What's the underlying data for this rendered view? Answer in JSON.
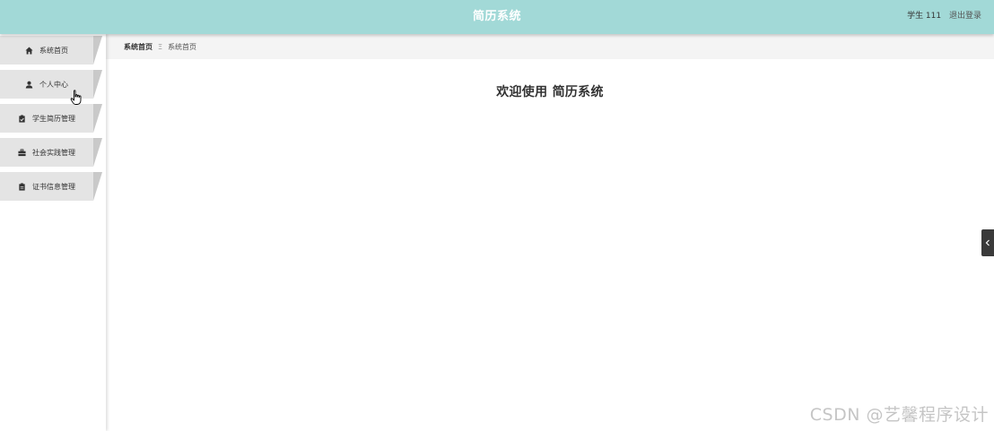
{
  "header": {
    "title": "简历系统",
    "user": "学生 111",
    "logout": "退出登录"
  },
  "sidebar": {
    "items": [
      {
        "label": "系统首页",
        "icon": "home-icon"
      },
      {
        "label": "个人中心",
        "icon": "user-icon"
      },
      {
        "label": "学生简历管理",
        "icon": "clipboard-icon"
      },
      {
        "label": "社会实践管理",
        "icon": "briefcase-icon"
      },
      {
        "label": "证书信息管理",
        "icon": "document-icon"
      }
    ]
  },
  "breadcrumb": {
    "home": "系统首页",
    "separator": "Ξ",
    "current": "系统首页"
  },
  "main": {
    "welcome": "欢迎使用 简历系统"
  },
  "watermark": "CSDN @艺馨程序设计",
  "colors": {
    "header_bg": "#a2d9d7",
    "nav_item_bg": "#e4e4e4",
    "nav_item_edge": "#c9c9c9",
    "toggle_bg": "#3a3a3a"
  }
}
